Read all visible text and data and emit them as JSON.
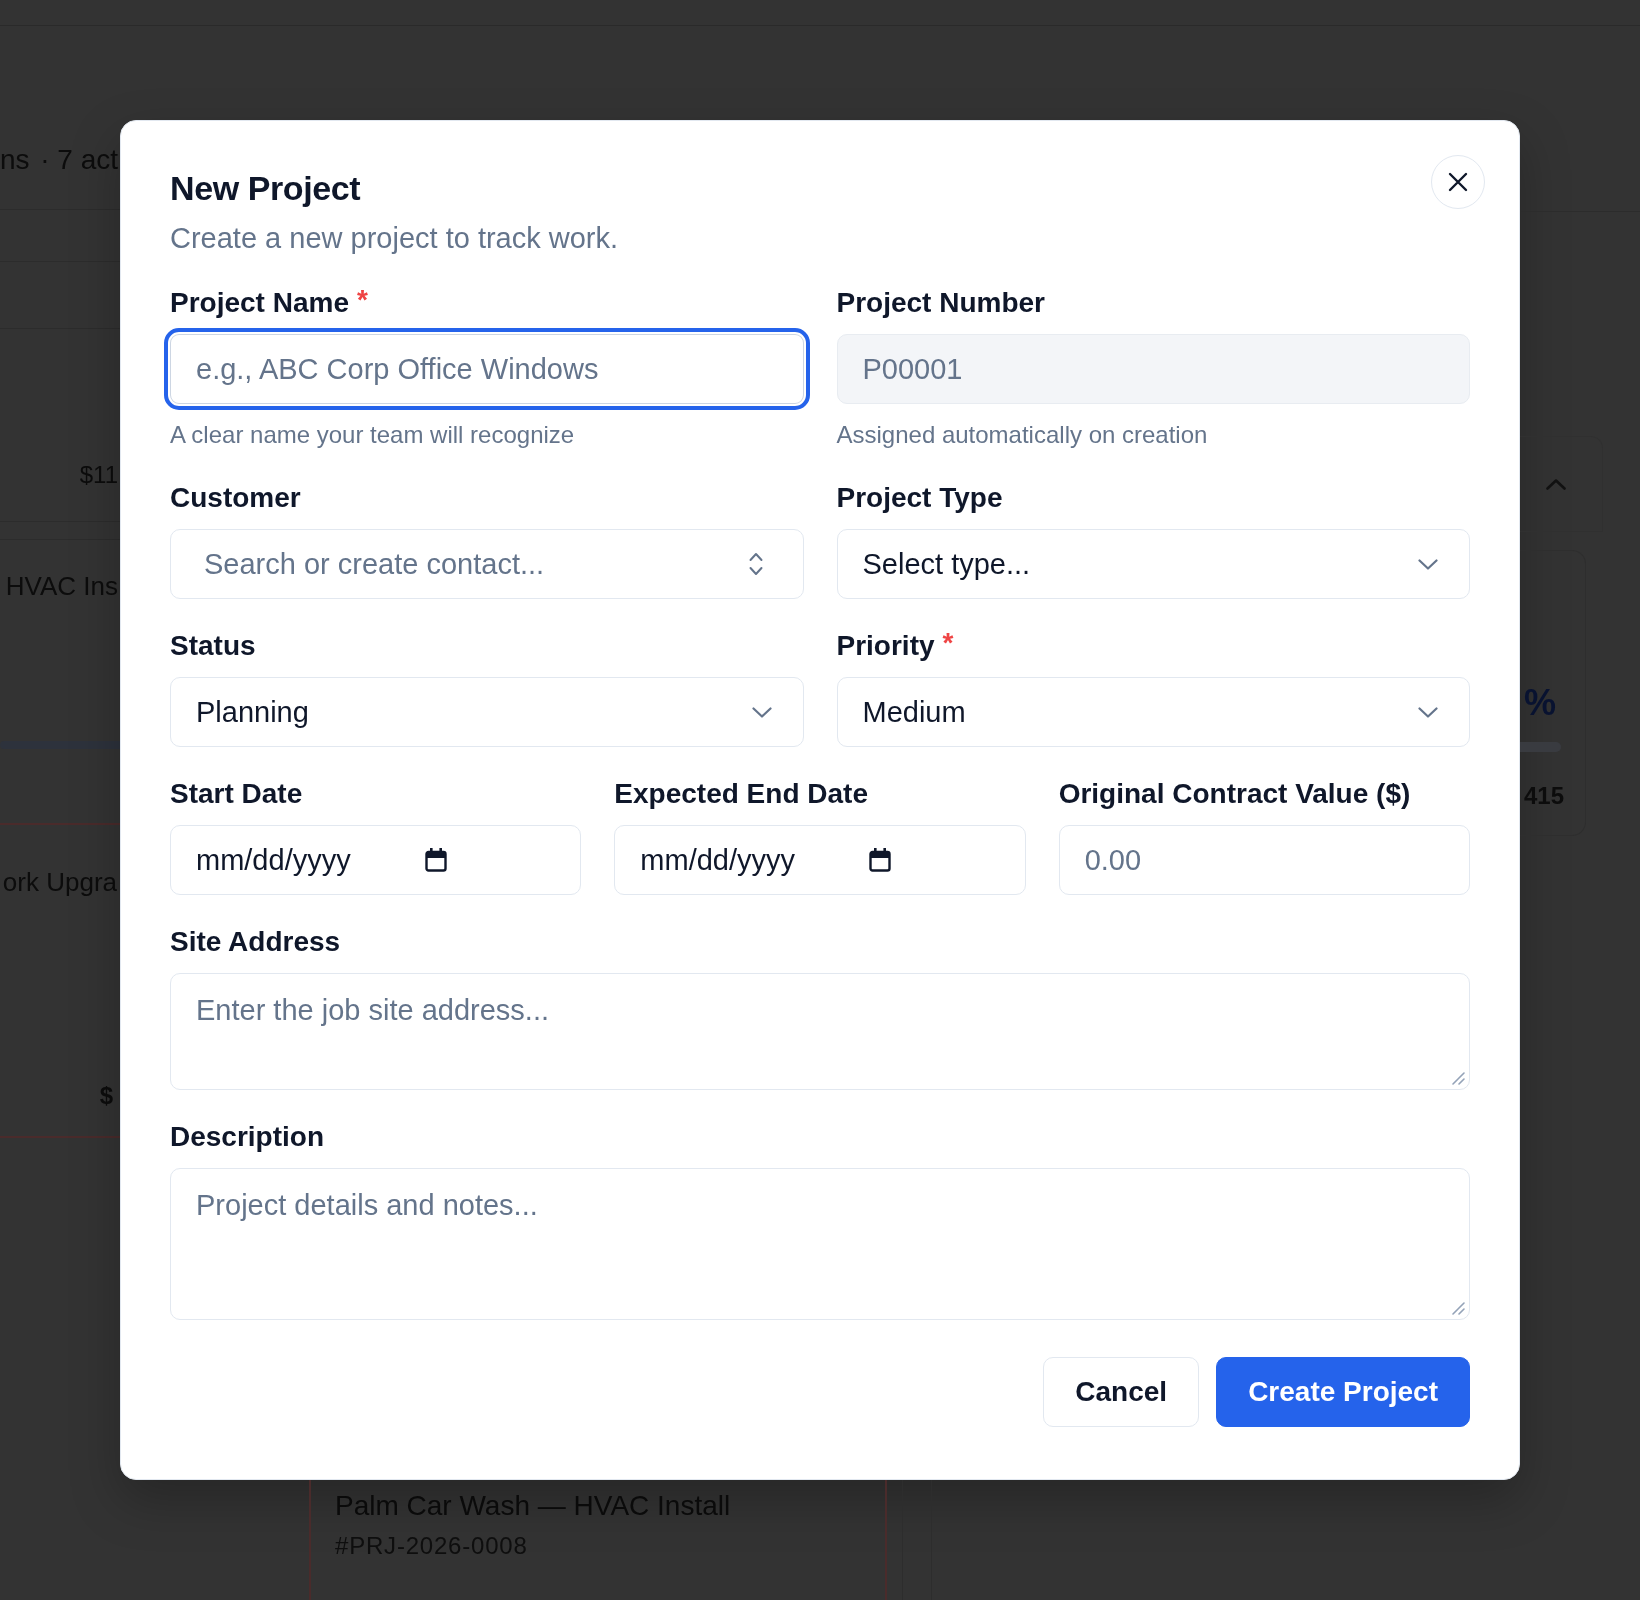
{
  "page_behind": {
    "summary_parts": [
      "ns",
      "· 7 act"
    ],
    "amount": "$11",
    "project_cards": [
      {
        "title": "HVAC Ins"
      },
      {
        "title": "ork Upgra",
        "amount": "$"
      }
    ],
    "side_card": {
      "percent": "%",
      "count": "415"
    },
    "bottom_card": {
      "title": "Palm Car Wash — HVAC Install",
      "number": "#PRJ-2026-0008"
    }
  },
  "dialog": {
    "title": "New Project",
    "description": "Create a new project to track work.",
    "rows": [
      {
        "fields": [
          {
            "label": "Project Name",
            "required_mark": "*",
            "kind": "text",
            "focused": true,
            "disabled": false,
            "placeholder": "e.g., ABC Corp Office Windows",
            "hint": "A clear name your team will recognize"
          },
          {
            "label": "Project Number",
            "kind": "text",
            "focused": false,
            "disabled": true,
            "value": "P00001",
            "hint": "Assigned automatically on creation"
          }
        ]
      },
      {
        "fields": [
          {
            "label": "Customer",
            "kind": "combobox",
            "focused": false,
            "disabled": false,
            "placeholder": "Search or create contact..."
          },
          {
            "label": "Project Type",
            "kind": "select",
            "focused": false,
            "disabled": false,
            "placeholder": "Select type..."
          }
        ]
      },
      {
        "fields": [
          {
            "label": "Status",
            "kind": "select",
            "focused": false,
            "disabled": false,
            "value": "Planning"
          },
          {
            "label": "Priority",
            "required_mark": "*",
            "kind": "select",
            "focused": false,
            "disabled": false,
            "value": "Medium"
          }
        ]
      },
      {
        "fields": [
          {
            "label": "Start Date",
            "kind": "date",
            "focused": false,
            "disabled": false,
            "placeholder": "mm/dd/yyyy"
          },
          {
            "label": "Expected End Date",
            "kind": "date",
            "focused": false,
            "disabled": false,
            "placeholder": "mm/dd/yyyy"
          },
          {
            "label": "Original Contract Value ($)",
            "kind": "text",
            "focused": false,
            "disabled": false,
            "placeholder": "0.00"
          }
        ]
      },
      {
        "fields": [
          {
            "label": "Site Address",
            "kind": "textarea",
            "focused": false,
            "disabled": false,
            "placeholder": "Enter the job site address..."
          }
        ]
      },
      {
        "fields": [
          {
            "label": "Description",
            "kind": "textarea",
            "focused": false,
            "disabled": false,
            "placeholder": "Project details and notes..."
          }
        ]
      }
    ],
    "buttons": [
      {
        "label": "Cancel",
        "kind": "secondary"
      },
      {
        "label": "Create Project",
        "kind": "primary"
      }
    ]
  }
}
